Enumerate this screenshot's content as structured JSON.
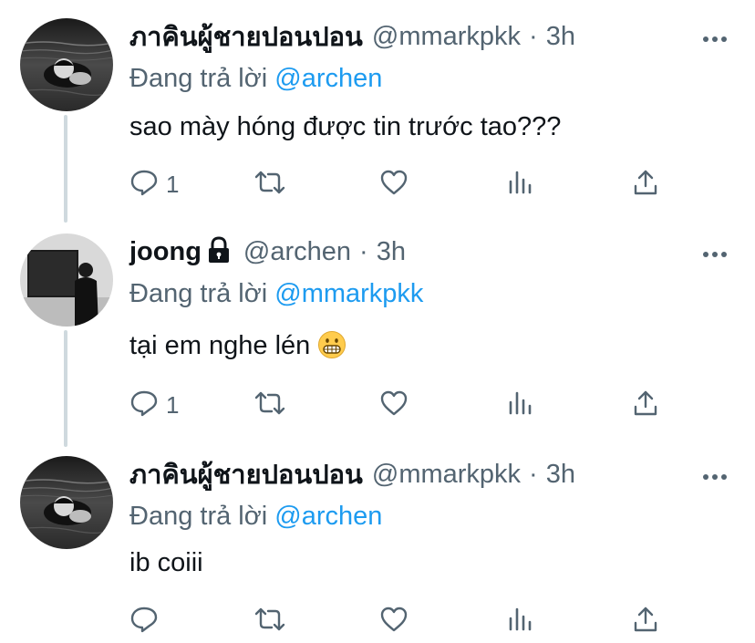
{
  "colors": {
    "text": "#0f1419",
    "secondary": "#536471",
    "link": "#1d9bf0",
    "thread": "#cfd9de"
  },
  "replying_prefix": "Đang trả lời",
  "tweets": [
    {
      "display_name": "ภาคินผู้ชายปอนปอน",
      "handle": "@mmarkpkk",
      "separator": "·",
      "time": "3h",
      "reply_to": "@archen",
      "text": "sao mày hóng được tin trước tao???",
      "reply_count": "1",
      "protected": false
    },
    {
      "display_name": "joong",
      "handle": "@archen",
      "separator": "·",
      "time": "3h",
      "reply_to": "@mmarkpkk",
      "text": "tại em nghe lén",
      "emoji": "grimacing-face",
      "reply_count": "1",
      "protected": true
    },
    {
      "display_name": "ภาคินผู้ชายปอนปอน",
      "handle": "@mmarkpkk",
      "separator": "·",
      "time": "3h",
      "reply_to": "@archen",
      "text": "ib coiii",
      "reply_count": "",
      "protected": false
    }
  ],
  "icons": [
    "more-icon",
    "reply-icon",
    "retweet-icon",
    "like-icon",
    "analytics-icon",
    "share-icon",
    "lock-icon"
  ]
}
